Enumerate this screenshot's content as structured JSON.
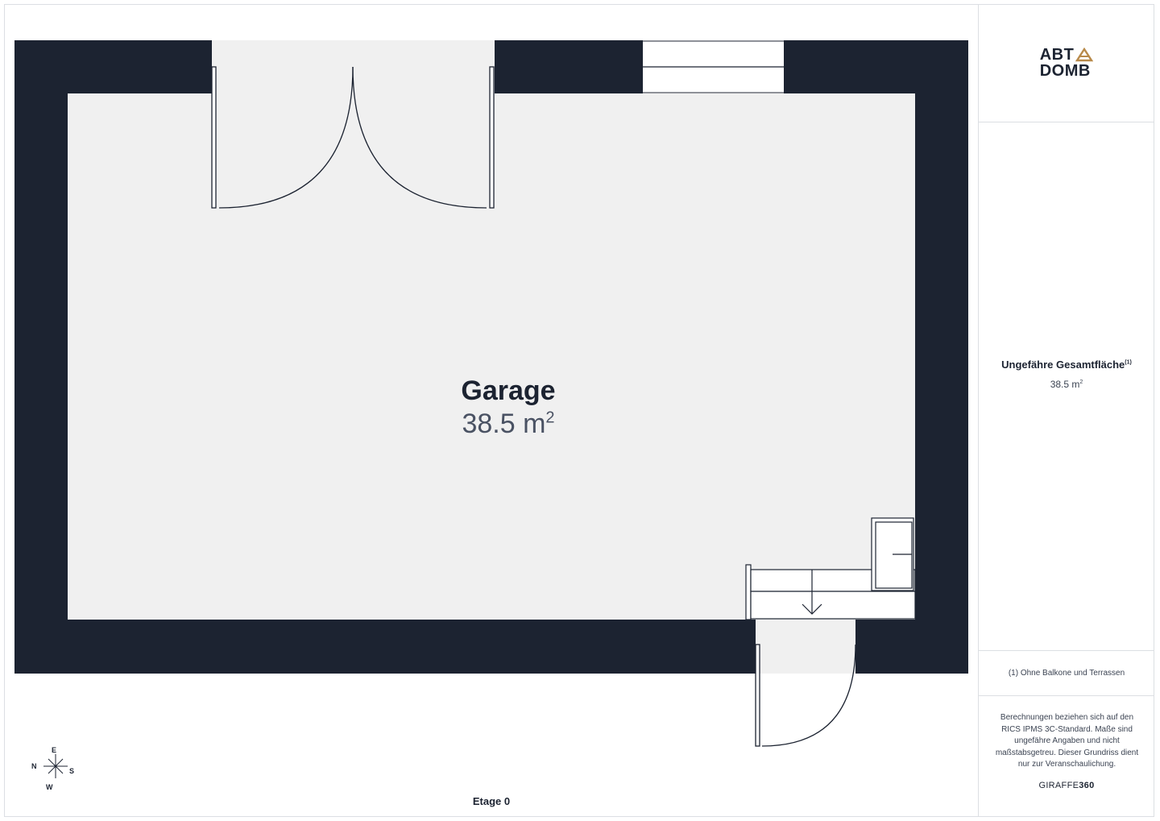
{
  "logo": {
    "line1": "ABT",
    "line2": "DOMB",
    "accent_color": "#b88a4a"
  },
  "room": {
    "name": "Garage",
    "area": "38.5 m",
    "area_unit_sup": "2"
  },
  "floor": {
    "label": "Etage 0"
  },
  "compass": {
    "n": "N",
    "e": "E",
    "s": "S",
    "w": "W"
  },
  "summary": {
    "title": "Ungefähre Gesamtfläche",
    "title_sup": "(1)",
    "value": "38.5 m",
    "value_sup": "2"
  },
  "footnote": "(1) Ohne Balkone und Terrassen",
  "disclaimer": "Berechnungen beziehen sich auf den RICS IPMS 3C-Standard. Maße sind ungefähre Angaben und nicht maßstabsgetreu. Dieser Grundriss dient nur zur Veranschaulichung.",
  "brand": {
    "prefix": "GIRAFFE",
    "suffix": "360"
  },
  "colors": {
    "wall": "#1c2331",
    "floor": "#f0f0f0",
    "line": "#1c2331"
  }
}
